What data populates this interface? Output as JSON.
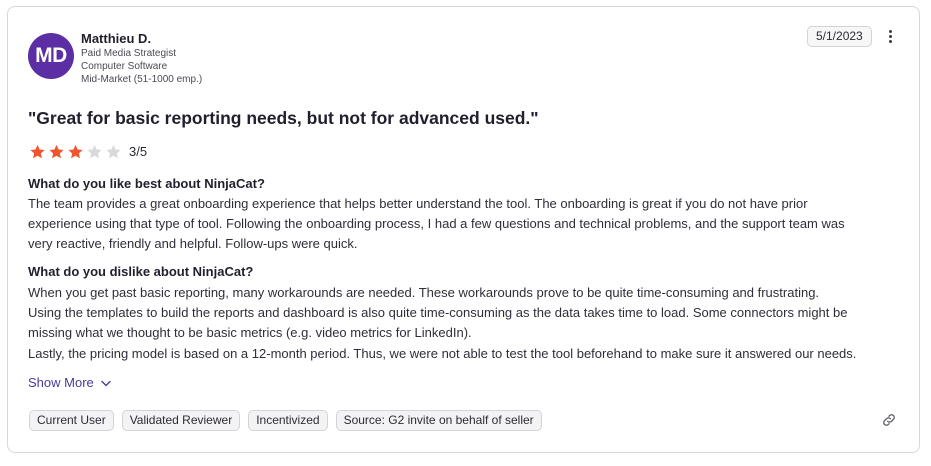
{
  "reviewer": {
    "initials": "MD",
    "name": "Matthieu D.",
    "title": "Paid Media Strategist",
    "industry": "Computer Software",
    "segment": "Mid-Market (51-1000 emp.)",
    "avatar_color": "#5b2fa3"
  },
  "review": {
    "date": "5/1/2023",
    "headline": "\"Great for basic reporting needs, but not for advanced used.\"",
    "rating": {
      "value": 3,
      "max": 5,
      "label": "3/5",
      "filled_color": "#f2542d",
      "empty_color": "#d9d9dd"
    },
    "like_question": "What do you like best about NinjaCat?",
    "like_lines": [
      "The team provides a great onboarding experience that helps better understand the tool. The onboarding is great if you do not have prior",
      "experience using that type of tool. Following the onboarding process, I had a few questions and technical problems, and the support team was",
      "very reactive, friendly and helpful. Follow-ups were quick."
    ],
    "dislike_question": "What do you dislike about NinjaCat?",
    "dislike_lines": [
      "When you get past basic reporting, many workarounds are needed. These workarounds prove to be quite time-consuming and frustrating.",
      "Using the templates to build the reports and dashboard is also quite time-consuming as the data takes time to load. Some connectors might be",
      "missing what we thought to be basic metrics (e.g. video metrics for LinkedIn).",
      "Lastly, the pricing model is based on a 12-month period. Thus, we were not able to test the tool beforehand to make sure it answered our needs."
    ],
    "show_more_label": "Show More"
  },
  "tags": [
    "Current User",
    "Validated Reviewer",
    "Incentivized",
    "Source: G2 invite on behalf of seller"
  ],
  "icons": {
    "menu": "more-vertical-icon",
    "expand": "chevron-down-icon",
    "share": "link-icon",
    "star": "star-icon"
  }
}
